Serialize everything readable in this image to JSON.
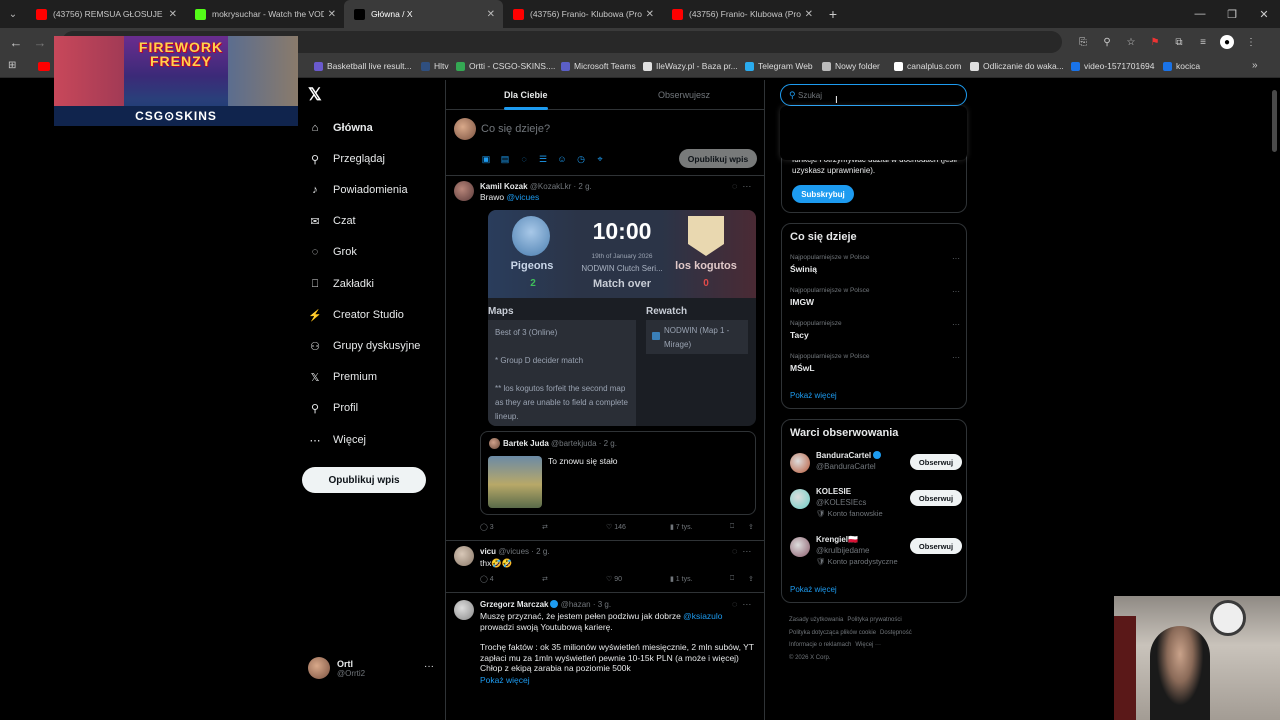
{
  "browser": {
    "tabs": [
      {
        "title": "(43756) REMSUA GŁOSUJE - ZL",
        "color": "#ff0000",
        "active": false
      },
      {
        "title": "mokrysuchar - Watch the VOD",
        "color": "#53fc18",
        "active": false
      },
      {
        "title": "Główna / X",
        "color": "#000000",
        "active": true
      },
      {
        "title": "(43756) Franio- Klubowa (Prod.",
        "color": "#ff0000",
        "active": false
      },
      {
        "title": "(43756) Franio- Klubowa (Prod.",
        "color": "#ff0000",
        "active": false
      }
    ],
    "bookmarks": [
      {
        "label": "Basketball live result...",
        "color": "#6a5acd"
      },
      {
        "label": "Hltv",
        "color": "#2f4f7f"
      },
      {
        "label": "Ortti - CSGO-SKINS....",
        "color": "#34a853"
      },
      {
        "label": "Microsoft Teams",
        "color": "#5b5fc7"
      },
      {
        "label": "IleWazy.pl - Baza pr...",
        "color": "#e0e0e0"
      },
      {
        "label": "Telegram Web",
        "color": "#2aabee"
      },
      {
        "label": "Nowy folder",
        "color": "#bbbbbb"
      },
      {
        "label": "canalplus.com",
        "color": "#ffffff"
      },
      {
        "label": "Odliczanie do waka...",
        "color": "#e0e0e0"
      },
      {
        "label": "video-1571701694",
        "color": "#1a73e8"
      },
      {
        "label": "kocica",
        "color": "#1a73e8"
      }
    ]
  },
  "promo": {
    "title": "FIREWORK FRENZY",
    "brand": "CSG⊙SKINS"
  },
  "nav": {
    "items": [
      {
        "label": "Główna",
        "icon": "home-icon",
        "glyph": "⌂",
        "bold": true
      },
      {
        "label": "Przeglądaj",
        "icon": "search-icon",
        "glyph": "⚲"
      },
      {
        "label": "Powiadomienia",
        "icon": "bell-icon",
        "glyph": "♪"
      },
      {
        "label": "Czat",
        "icon": "mail-icon",
        "glyph": "✉"
      },
      {
        "label": "Grok",
        "icon": "grok-icon",
        "glyph": "◌"
      },
      {
        "label": "Zakładki",
        "icon": "bookmark-icon",
        "glyph": "⎕"
      },
      {
        "label": "Creator Studio",
        "icon": "creator-icon",
        "glyph": "⚡"
      },
      {
        "label": "Grupy dyskusyjne",
        "icon": "communities-icon",
        "glyph": "⚇"
      },
      {
        "label": "Premium",
        "icon": "x-premium-icon",
        "glyph": "𝕏"
      },
      {
        "label": "Profil",
        "icon": "profile-icon",
        "glyph": "⚲"
      },
      {
        "label": "Więcej",
        "icon": "more-icon",
        "glyph": "⋯"
      }
    ],
    "post_label": "Opublikuj wpis",
    "me": {
      "name": "Ortl",
      "handle": "@Orrti2"
    }
  },
  "timeline": {
    "tabs": [
      "Dla Ciebie",
      "Obserwujesz"
    ],
    "composer": {
      "placeholder": "Co się dzieje?",
      "post_label": "Opublikuj wpis"
    },
    "post1": {
      "name": "Kamil Kozak",
      "meta": "@KozakLkr · 2 g.",
      "text_prefix": "Brawo",
      "mention": "@vicues",
      "match": {
        "team_left": "Pigeons",
        "team_right": "los kogutos",
        "score_left": "2",
        "score_right": "0",
        "time": "10:00",
        "date": "19th of January 2026",
        "event": "NODWIN Clutch Seri...",
        "status": "Match over",
        "maps_header": "Maps",
        "rewatch_header": "Rewatch",
        "maps_lines": [
          "Best of 3 (Online)",
          "* Group D decider match",
          "** los kogutos forfeit the second map as they are unable to field a complete lineup."
        ],
        "rewatch_label": "NODWIN (Map 1 - Mirage)"
      },
      "quote": {
        "name": "Bartek Juda",
        "meta": "@bartekjuda · 2 g.",
        "text": "To znowu się stało"
      },
      "actions": {
        "replies": "3",
        "likes": "146",
        "views": "7 tys."
      }
    },
    "post2": {
      "name": "vicu",
      "meta": "@vicues · 2 g.",
      "text": "thx🤣🤣",
      "actions": {
        "replies": "4",
        "likes": "90",
        "views": "1 tys."
      }
    },
    "post3": {
      "name": "Grzegorz Marczak",
      "meta": "@hazan · 3 g.",
      "text_a": "Muszę przyznać, że jestem pełen podziwu jak dobrze",
      "mention": "@ksiazulo",
      "text_b": "prowadzi swoją Youtubową karierę.",
      "text_c": "Trochę faktów : ok 35 milionów wyświetleń miesięcznie, 2 mln subów, YT zapłaci mu za 1mln wyświetleń pewnie 10-15k PLN (a może i więcej) Chłop z ekipą zarabia  na poziomie 500k",
      "more": "Pokaż więcej"
    }
  },
  "right": {
    "search_placeholder": "Szukaj",
    "subscribe": {
      "text": "funkcje i otrzymywać udział w dochodach (jeśli uzyskasz uprawnienie).",
      "button": "Subskrybuj"
    },
    "trends": {
      "title": "Co się dzieje",
      "items": [
        {
          "category": "Najpopularniejsze w Polsce",
          "topic": "Świnią"
        },
        {
          "category": "Najpopularniejsze w Polsce",
          "topic": "IMGW"
        },
        {
          "category": "Najpopularniejsze",
          "topic": "Tacy"
        },
        {
          "category": "Najpopularniejsze w Polsce",
          "topic": "MŚwL"
        }
      ],
      "more": "Pokaż więcej"
    },
    "follow": {
      "title": "Warci obserwowania",
      "items": [
        {
          "name": "BanduraCartel",
          "handle": "@BanduraCartel",
          "label": "",
          "button": "Obserwuj",
          "verified": true,
          "color": "#b85a3a"
        },
        {
          "name": "KOLESIE",
          "handle": "@KOLESIEcs",
          "label": "🛡 Konto fanowskie",
          "button": "Obserwuj",
          "verified": false,
          "color": "#6ad0c8"
        },
        {
          "name": "Krengiel🇵🇱",
          "handle": "@krulbijedame",
          "label": "🛡 Konto parodystyczne",
          "button": "Obserwuj",
          "verified": false,
          "color": "#8a5a6a"
        }
      ],
      "more": "Pokaż więcej"
    },
    "footer": [
      "Zasady użytkowania",
      "Polityka prywatności",
      "Polityka dotycząca plików cookie",
      "Dostępność",
      "Informacje o reklamach",
      "Więcej ···",
      "© 2026 X Corp."
    ]
  }
}
